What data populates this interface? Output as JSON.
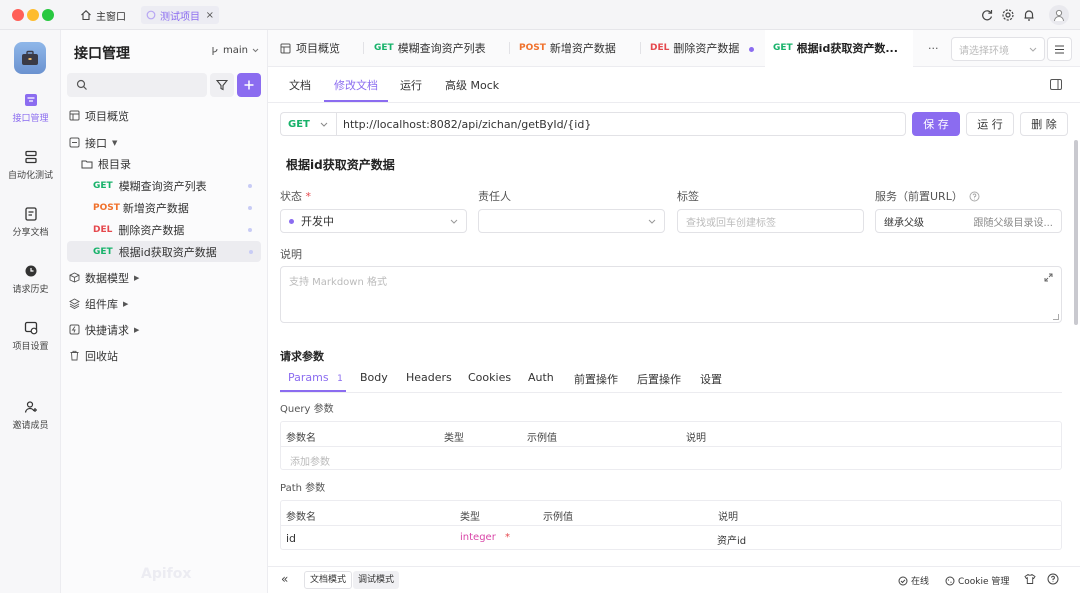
{
  "titlebar": {
    "home_tab": "主窗口",
    "project_tab": "测试项目"
  },
  "rail": {
    "items": [
      "接口管理",
      "自动化测试",
      "分享文档",
      "请求历史",
      "项目设置",
      "邀请成员"
    ]
  },
  "sidebar": {
    "title": "接口管理",
    "branch": "main",
    "tree": {
      "overview": "项目概览",
      "api": "接口",
      "root": "根目录",
      "endpoints": [
        {
          "method": "GET",
          "name": "模糊查询资产列表"
        },
        {
          "method": "POST",
          "name": "新增资产数据"
        },
        {
          "method": "DEL",
          "name": "删除资产数据"
        },
        {
          "method": "GET",
          "name": "根据id获取资产数据"
        }
      ],
      "models": "数据模型",
      "components": "组件库",
      "quick": "快捷请求",
      "trash": "回收站"
    },
    "watermark": "Apifox"
  },
  "tabs": {
    "overview": "项目概览",
    "items": [
      {
        "method": "GET",
        "name": "模糊查询资产列表"
      },
      {
        "method": "POST",
        "name": "新增资产数据"
      },
      {
        "method": "DEL",
        "name": "删除资产数据"
      },
      {
        "method": "GET",
        "name": "根据id获取资产数..."
      }
    ],
    "more": "···",
    "env_placeholder": "请选择环境"
  },
  "subtabs": [
    "文档",
    "修改文档",
    "运行",
    "高级 Mock"
  ],
  "request": {
    "method": "GET",
    "url": "http://localhost:8082/api/zichan/getById/{id}",
    "save": "保 存",
    "run": "运 行",
    "delete": "删 除"
  },
  "doc": {
    "title": "根据id获取资产数据",
    "status_label": "状态",
    "required_mark": "*",
    "status_value": "开发中",
    "owner_label": "责任人",
    "tag_label": "标签",
    "tag_placeholder": "查找或回车创建标签",
    "service_label": "服务（前置URL）",
    "service_inherit": "继承父级",
    "service_follow": "跟随父级目录设...",
    "desc_label": "说明",
    "desc_placeholder": "支持 Markdown 格式"
  },
  "params": {
    "title": "请求参数",
    "tabs": [
      "Params",
      "Body",
      "Headers",
      "Cookies",
      "Auth",
      "前置操作",
      "后置操作",
      "设置"
    ],
    "params_count": "1",
    "query_title": "Query 参数",
    "headers": [
      "参数名",
      "类型",
      "示例值",
      "说明"
    ],
    "add_param": "添加参数",
    "path_title": "Path 参数",
    "path_rows": [
      {
        "name": "id",
        "type": "integer",
        "required": "*",
        "example": "",
        "desc": "资产id"
      }
    ]
  },
  "bottom": {
    "collapse": "«",
    "doc_mode": "文档模式",
    "debug_mode": "调试模式",
    "online": "在线",
    "cookie": "Cookie 管理"
  },
  "colors": {
    "accent": "#8b6cf0",
    "get": "#17b26a",
    "post": "#f0712c",
    "del": "#e5484d"
  }
}
